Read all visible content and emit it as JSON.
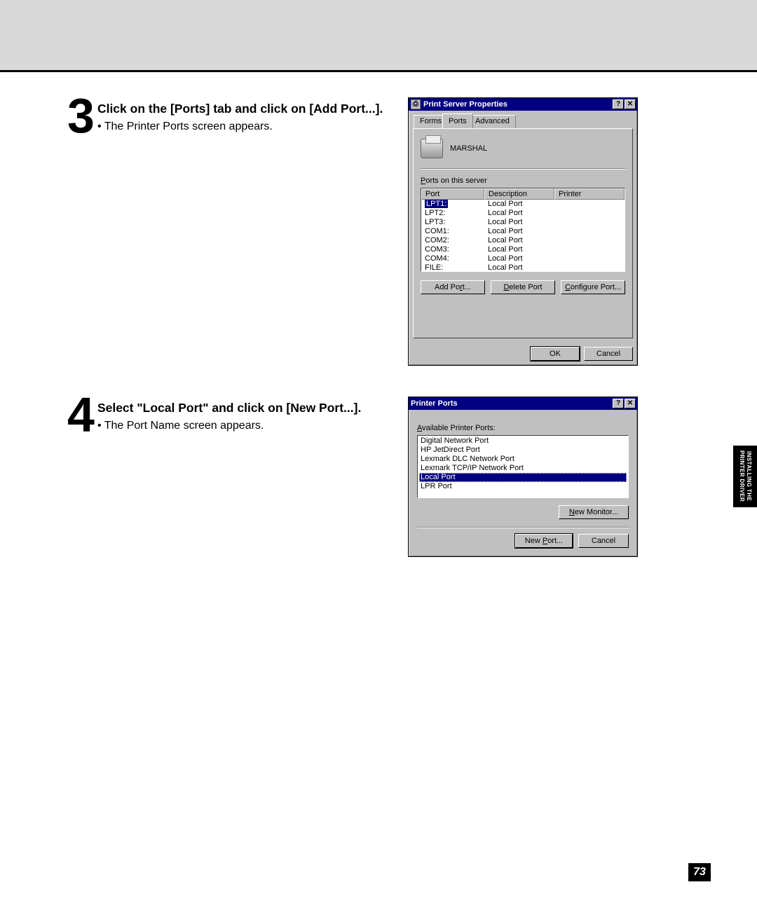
{
  "side_tab": {
    "line1": "INSTALLING THE",
    "line2": "PRINTER DRIVER"
  },
  "page_number": "73",
  "step3": {
    "number": "3",
    "title": "Click on the [Ports] tab and click on [Add Port...].",
    "bullet": "• The Printer Ports screen appears."
  },
  "step4": {
    "number": "4",
    "title": "Select \"Local Port\" and click on [New Port...].",
    "bullet": "• The Port Name screen appears."
  },
  "dlg1": {
    "title": "Print Server Properties",
    "tabs": [
      "Forms",
      "Ports",
      "Advanced"
    ],
    "server_name": "MARSHAL",
    "label_ports_on_server": "Ports on this server",
    "columns": {
      "port": "Port",
      "desc": "Description",
      "printer": "Printer"
    },
    "rows": [
      {
        "port": "LPT1:",
        "desc": "Local Port",
        "selected": true
      },
      {
        "port": "LPT2:",
        "desc": "Local Port"
      },
      {
        "port": "LPT3:",
        "desc": "Local Port"
      },
      {
        "port": "COM1:",
        "desc": "Local Port"
      },
      {
        "port": "COM2:",
        "desc": "Local Port"
      },
      {
        "port": "COM3:",
        "desc": "Local Port"
      },
      {
        "port": "COM4:",
        "desc": "Local Port"
      },
      {
        "port": "FILE:",
        "desc": "Local Port"
      }
    ],
    "buttons": {
      "add": "Add Port...",
      "del": "Delete Port",
      "cfg": "Configure Port..."
    },
    "footer": {
      "ok": "OK",
      "cancel": "Cancel"
    }
  },
  "dlg2": {
    "title": "Printer Ports",
    "label_available": "Available Printer Ports:",
    "items": [
      "Digital Network Port",
      "HP JetDirect Port",
      "Lexmark DLC Network Port",
      "Lexmark TCP/IP Network Port",
      "Local Port",
      "LPR Port"
    ],
    "selected_index": 4,
    "buttons": {
      "new_monitor": "New Monitor...",
      "new_port": "New Port...",
      "cancel": "Cancel"
    }
  }
}
